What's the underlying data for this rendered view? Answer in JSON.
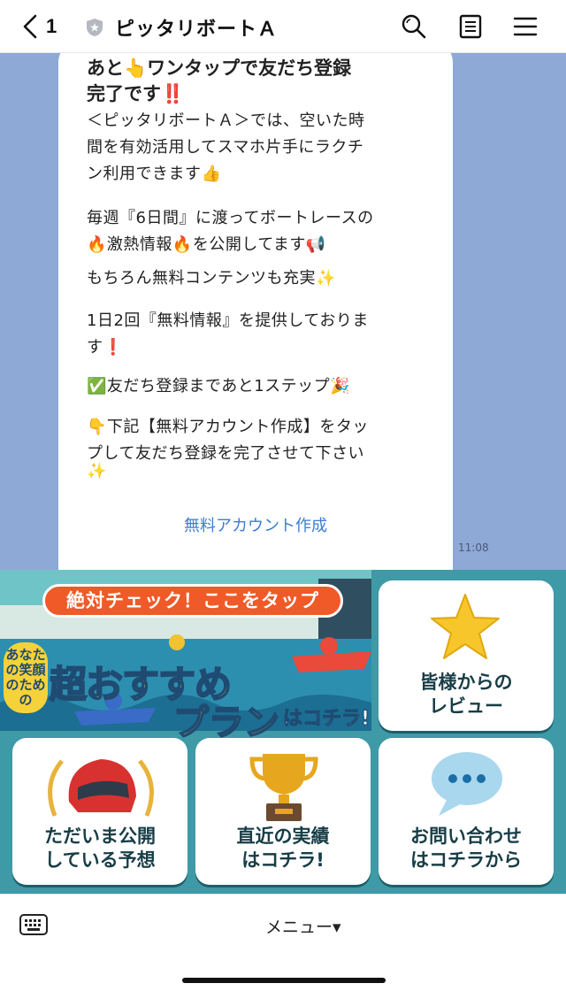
{
  "header": {
    "back_count": "1",
    "title": "ピッタリボートＡ",
    "icons": [
      "back-chevron-icon",
      "shield-icon",
      "search-icon",
      "notes-icon",
      "menu-icon"
    ]
  },
  "message": {
    "title_line1": "あと👆ワンタップで友だち登録",
    "title_line2": "完了です‼️",
    "lines": [
      "＜ピッタリボートＡ＞では、空いた時",
      "間を有効活用してスマホ片手にラクチ",
      "ン利用できます👍",
      "毎週『6日間』に渡ってボートレースの",
      "🔥激熱情報🔥を公開してます📢",
      "もちろん無料コンテンツも充実✨",
      "1日2回『無料情報』を提供しておりま",
      "す❗",
      "✅友だち登録まであと1ステップ🎉",
      "👇下記【無料アカウント作成】をタッ",
      "プして友だち登録を完了させて下さい",
      "✨"
    ],
    "link_label": "無料アカウント作成",
    "time": "11:08"
  },
  "rich_menu": {
    "banner": {
      "pill": "絶対チェック！ここをタップ",
      "vertical": "あなたの笑顔のための",
      "main": "超おすすめ",
      "sub": "プラン",
      "tail": "はコチラ!"
    },
    "review": {
      "line1": "皆様からの",
      "line2": "レビュー"
    },
    "forecast": {
      "line1": "ただいま公開",
      "line2": "している予想"
    },
    "results": {
      "line1": "直近の実績",
      "line2": "はコチラ!"
    },
    "contact": {
      "line1": "お問い合わせ",
      "line2": "はコチラから"
    },
    "colors": {
      "background": "#3e9aa6",
      "pill": "#ef5a28",
      "title_yellow": "#f6d23a"
    }
  },
  "bottom_bar": {
    "menu_label": "メニュー▾",
    "keyboard_icon": "keyboard-icon"
  }
}
